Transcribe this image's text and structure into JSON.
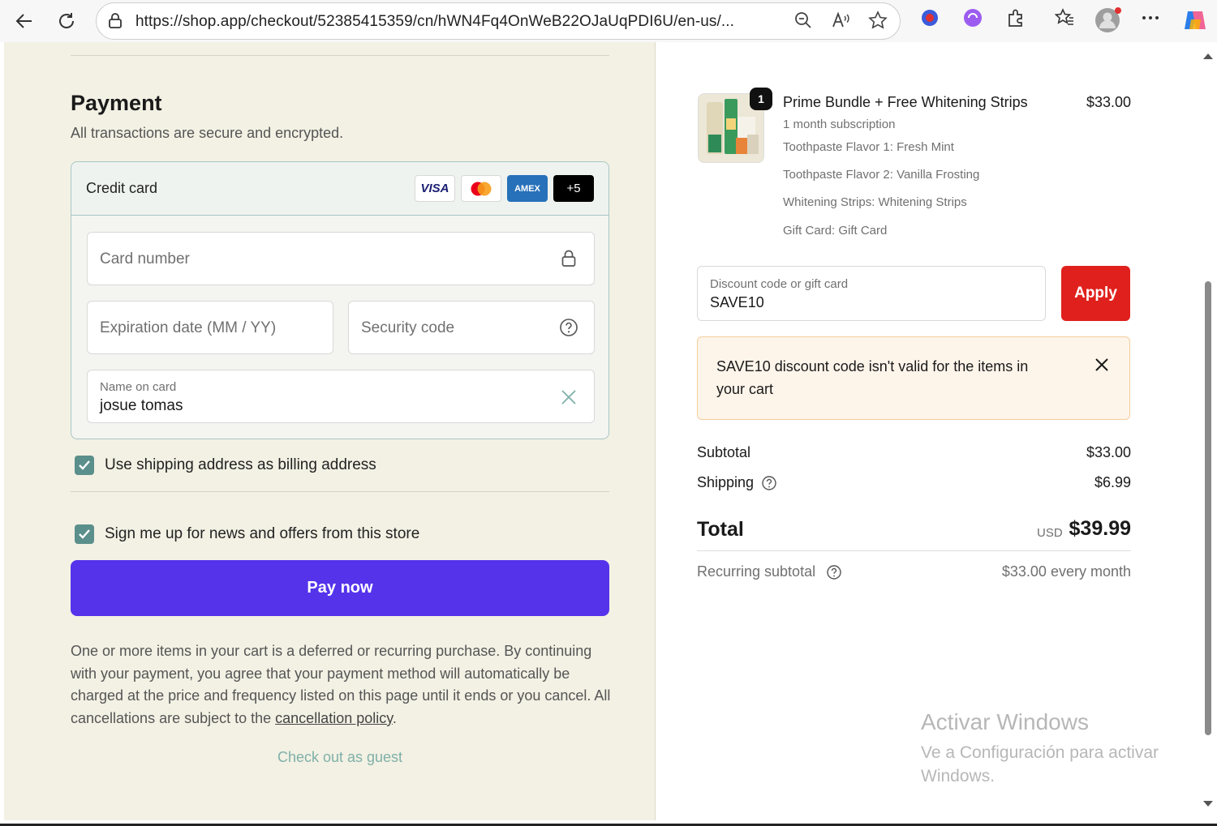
{
  "browser": {
    "url": "https://shop.app/checkout/52385415359/cn/hWN4Fq4OnWeB22OJaUqPDI6U/en-us/..."
  },
  "payment": {
    "title": "Payment",
    "subtitle": "All transactions are secure and encrypted.",
    "method_label": "Credit card",
    "card_logos": [
      "VISA",
      "Mastercard",
      "AMEX",
      "+5"
    ],
    "card_number_placeholder": "Card number",
    "expiration_placeholder": "Expiration date (MM / YY)",
    "security_placeholder": "Security code",
    "name_label": "Name on card",
    "name_value": "josue tomas",
    "billing_checkbox_label": "Use shipping address as billing address",
    "billing_checked": true,
    "news_checkbox_label": "Sign me up for news and offers from this store",
    "news_checked": true,
    "pay_button": "Pay now",
    "legal_text": "One or more items in your cart is a deferred or recurring purchase. By continuing with your payment, you agree that your payment method will automatically be charged at the price and frequency listed on this page until it ends or you cancel. All cancellations are subject to the ",
    "legal_link": "cancellation policy",
    "legal_end": ".",
    "guest_link": "Check out as guest"
  },
  "order": {
    "quantity": "1",
    "product_name": "Prime Bundle + Free Whitening Strips",
    "product_price": "$33.00",
    "details": [
      "1 month subscription",
      "Toothpaste Flavor 1: Fresh Mint",
      "Toothpaste Flavor 2: Vanilla Frosting",
      "Whitening Strips: Whitening Strips",
      "Gift Card: Gift Card"
    ],
    "discount_label": "Discount code or gift card",
    "discount_value": "SAVE10",
    "apply_button": "Apply",
    "alert_text": "SAVE10 discount code isn't valid for the items in your cart",
    "subtotal_label": "Subtotal",
    "subtotal_value": "$33.00",
    "shipping_label": "Shipping",
    "shipping_value": "$6.99",
    "total_label": "Total",
    "total_currency": "USD",
    "total_value": "$39.99",
    "recurring_label": "Recurring subtotal",
    "recurring_value": "$33.00 every month"
  },
  "watermark": {
    "title": "Activar Windows",
    "subtitle": "Ve a Configuración para activar Windows."
  },
  "colors": {
    "pay_button": "#5433eb",
    "apply_button": "#e0201c",
    "left_background": "#f3f1e4",
    "checkbox": "#5b8f8b"
  }
}
